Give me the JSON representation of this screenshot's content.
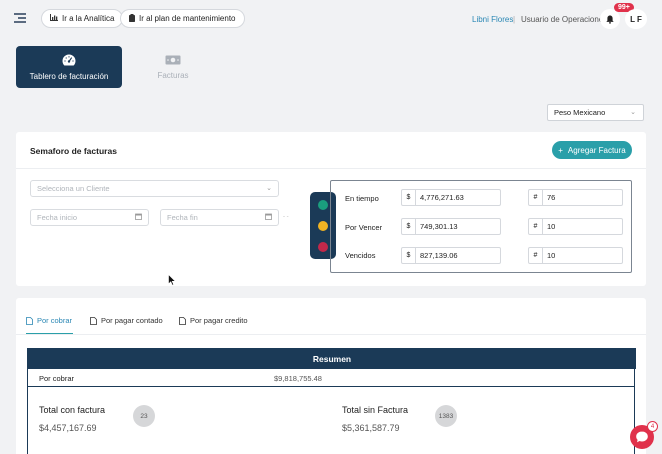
{
  "header": {
    "btn_analytics": "Ir a la Analítica",
    "btn_maintenance": "Ir al plan de mantenimiento",
    "user_name": "Libni Flores",
    "separator": "|",
    "user_role": "Usuario de Operaciones",
    "notifications": "99+",
    "avatar": "L F"
  },
  "nav": {
    "billing_dashboard": "Tablero de facturación",
    "invoices": "Facturas"
  },
  "currency": {
    "selected": "Peso Mexicano"
  },
  "semaforo": {
    "title": "Semaforo de facturas",
    "add_button": "Agregar Factura",
    "client_placeholder": "Selecciona un Cliente",
    "start_date_placeholder": "Fecha inicio",
    "end_date_placeholder": "Fecha fin",
    "rows": [
      {
        "label": "En tiempo",
        "currency": "$",
        "amount": "4,776,271.63",
        "hash": "#",
        "count": "76"
      },
      {
        "label": "Por Vencer",
        "currency": "$",
        "amount": "749,301.13",
        "hash": "#",
        "count": "10"
      },
      {
        "label": "Vencidos",
        "currency": "$",
        "amount": "827,139.06",
        "hash": "#",
        "count": "10"
      }
    ],
    "colors": {
      "green": "#1a9e7e",
      "yellow": "#f0b323",
      "red": "#c3284a"
    }
  },
  "tabs": {
    "por_cobrar": "Por cobrar",
    "por_pagar_contado": "Por pagar contado",
    "por_pagar_credito": "Por pagar credito"
  },
  "resumen": {
    "title": "Resumen",
    "row_label": "Por cobrar",
    "row_amount": "$9,818,755.48",
    "con_factura_title": "Total con factura",
    "con_factura_amount": "$4,457,167.69",
    "con_factura_count": "23",
    "sin_factura_title": "Total sin Factura",
    "sin_factura_amount": "$5,361,587.79",
    "sin_factura_count": "1383"
  },
  "chat": {
    "badge": "4"
  }
}
